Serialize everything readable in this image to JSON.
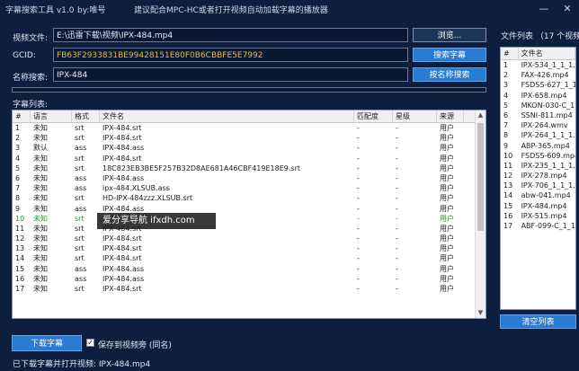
{
  "titlebar": {
    "app_title": "字幕搜索工具 v1.0",
    "author": "by:唯号",
    "hint": "建议配合MPC-HC或者打开视频自动加载字幕的播放器",
    "minimize": "—",
    "close": "✕"
  },
  "form": {
    "video_label": "视频文件:",
    "video_value": "E:\\迅雷下载\\视频\\IPX-484.mp4",
    "browse_button": "浏览...",
    "gcid_label": "GCID:",
    "gcid_value": "FB63F2933831BE99428151E80F0B6CBBFE5E7992",
    "search_sub_button": "搜索字幕",
    "name_label": "名称搜索:",
    "name_value": "IPX-484",
    "search_name_button": "按名称搜索",
    "progress": 0
  },
  "subtitle_list": {
    "label": "字幕列表:",
    "headers": [
      "#",
      "语言",
      "格式",
      "文件名",
      "匹配度",
      "星级",
      "来源"
    ],
    "rows": [
      [
        "1",
        "未知",
        "srt",
        "IPX-484.srt",
        "-",
        "-",
        "用户"
      ],
      [
        "2",
        "未知",
        "srt",
        "IPX-484.srt",
        "-",
        "-",
        "用户"
      ],
      [
        "3",
        "默认",
        "ass",
        "IPX-484.ass",
        "-",
        "-",
        "用户"
      ],
      [
        "4",
        "未知",
        "srt",
        "IPX-484.srt",
        "-",
        "-",
        "用户"
      ],
      [
        "5",
        "未知",
        "srt",
        "18C823EB3BE5F257B32D8AE681A46CBF419E18E9.srt",
        "-",
        "-",
        "用户"
      ],
      [
        "6",
        "未知",
        "ass",
        "IPX-484.ass",
        "-",
        "-",
        "用户"
      ],
      [
        "7",
        "未知",
        "ass",
        "ipx-484.XLSUB.ass",
        "-",
        "-",
        "用户"
      ],
      [
        "8",
        "未知",
        "srt",
        "HD-IPX-484zzz.XLSUB.srt",
        "-",
        "-",
        "用户"
      ],
      [
        "9",
        "未知",
        "ass",
        "IPX-484.ass",
        "-",
        "-",
        "用户"
      ],
      [
        "10",
        "未知",
        "srt",
        "IPX-484.srt",
        "-",
        "-",
        "用户"
      ],
      [
        "11",
        "未知",
        "srt",
        "IPX-484.srt",
        "-",
        "-",
        "用户"
      ],
      [
        "12",
        "未知",
        "srt",
        "IPX-484.srt",
        "-",
        "-",
        "用户"
      ],
      [
        "13",
        "未知",
        "srt",
        "IPX-484.srt",
        "-",
        "-",
        "用户"
      ],
      [
        "14",
        "未知",
        "srt",
        "IPX-484.srt",
        "-",
        "-",
        "用户"
      ],
      [
        "15",
        "未知",
        "ass",
        "IPX-484.ass",
        "-",
        "-",
        "用户"
      ],
      [
        "16",
        "未知",
        "ass",
        "IPX-484.ass",
        "-",
        "-",
        "用户"
      ],
      [
        "17",
        "未知",
        "srt",
        "IPX-484.srt",
        "-",
        "-",
        "用户"
      ]
    ],
    "highlight_row": 9,
    "highlight_color": "#1e9a36"
  },
  "watermark": "爱分享导航 ifxdh.com",
  "file_list": {
    "label": "文件列表 （17 个视频）",
    "headers": [
      "#",
      "文件名"
    ],
    "rows": [
      [
        "1",
        "IPX-534_1_1_1.n"
      ],
      [
        "2",
        "FAX-426.mp4"
      ],
      [
        "3",
        "FSDSS-627_1_1_"
      ],
      [
        "4",
        "IPX-658.mp4"
      ],
      [
        "5",
        "MKON-030-C_1"
      ],
      [
        "6",
        "SSNI-811.mp4"
      ],
      [
        "7",
        "IPX-264.wmv"
      ],
      [
        "8",
        "IPX-264_1_1_1.n"
      ],
      [
        "9",
        "ABP-365.mp4"
      ],
      [
        "10",
        "FSDSS-609.mp4"
      ],
      [
        "11",
        "IPX-235_1_1_1.n"
      ],
      [
        "12",
        "IPX-278.mp4"
      ],
      [
        "13",
        "IPX-706_1_1_1.n"
      ],
      [
        "14",
        "abw-041.mp4"
      ],
      [
        "15",
        "IPX-484.mp4"
      ],
      [
        "16",
        "IPX-515.mp4"
      ],
      [
        "17",
        "ABF-099-C_1_1_"
      ]
    ],
    "clear_button": "清空列表"
  },
  "bottom": {
    "download_button": "下载字幕",
    "save_checkbox_label": "保存到视频旁 (同名)",
    "save_checked": true,
    "status": "已下载字幕并打开视频: IPX-484.mp4"
  },
  "colors": {
    "background": "#0d1e3f",
    "accent": "#2a7bd2"
  }
}
